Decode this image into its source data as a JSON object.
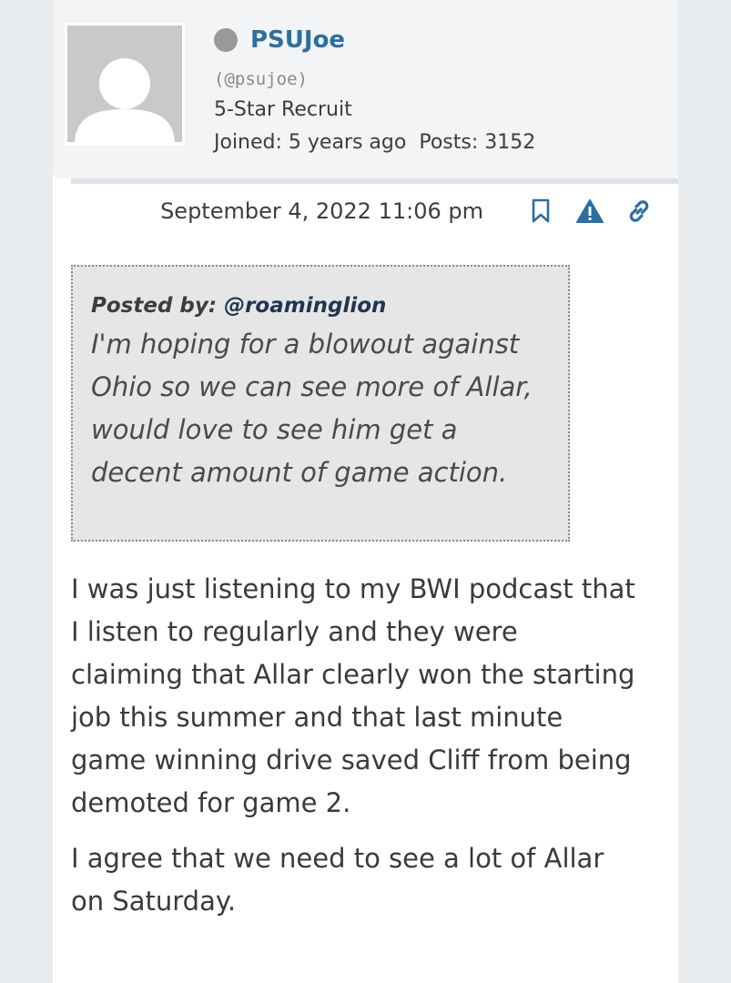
{
  "author": {
    "name": "PSUJoe",
    "handle": "(@psujoe)",
    "rank": "5-Star Recruit",
    "joined": "Joined: 5 years ago",
    "posts": "Posts: 3152",
    "status_color": "#999999",
    "avatar_icon": "default-user-avatar"
  },
  "post": {
    "date": "September 4, 2022 11:06 pm",
    "actions": {
      "bookmark_icon": "bookmark-icon",
      "report_icon": "warning-icon",
      "link_icon": "link-icon"
    },
    "quote": {
      "label": "Posted by:",
      "author": "@roaminglion",
      "text": "I'm hoping for a blowout against Ohio so we can see more of Allar, would love to see him get a decent amount of game action."
    },
    "paragraphs": [
      "I was just listening to my BWI podcast that I listen to regularly and they were claiming that Allar clearly won the starting job this summer and that last minute game winning drive saved Cliff from being demoted for game 2.",
      "I agree that we need to see a lot of Allar on Saturday."
    ]
  },
  "colors": {
    "accent": "#2e6f9e",
    "icon": "#2e6f9e",
    "quote_bg": "#e6e6e6"
  }
}
